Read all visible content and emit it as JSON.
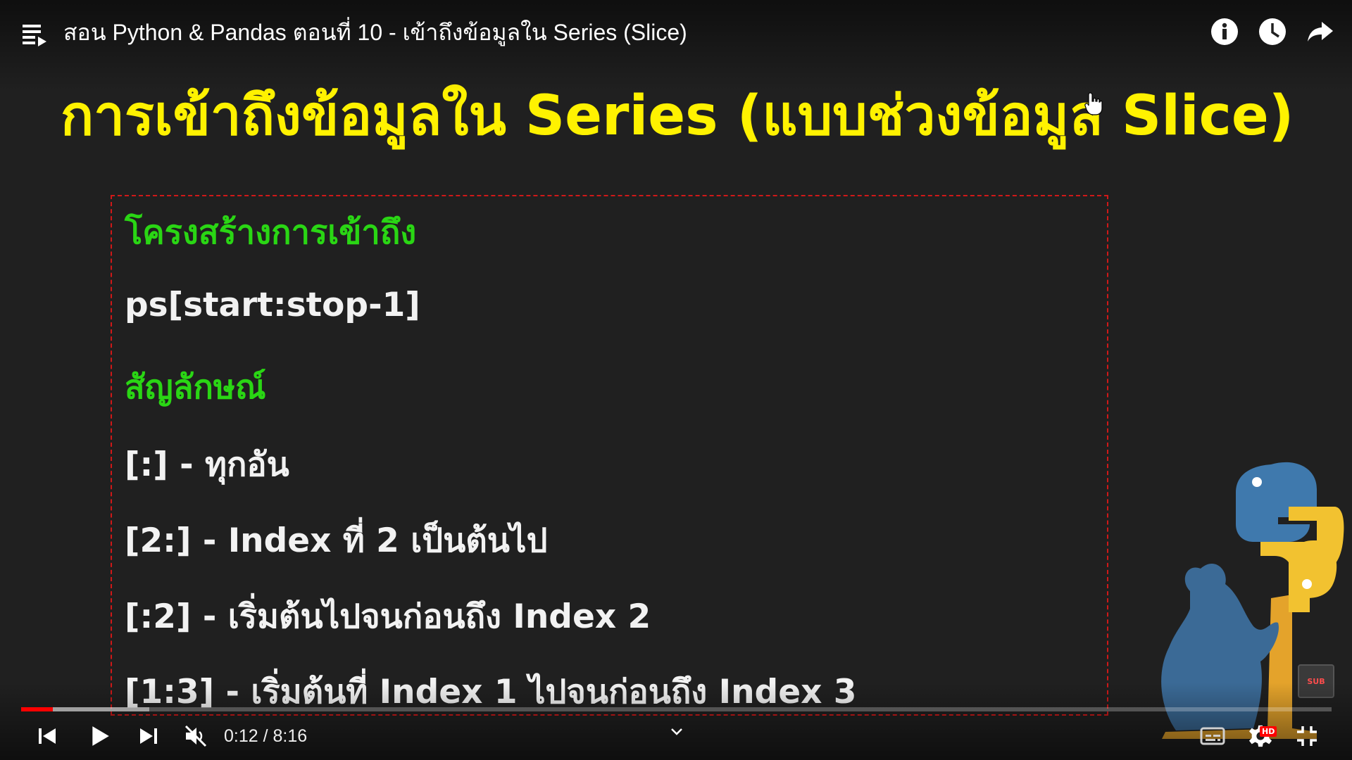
{
  "header": {
    "title": "สอน Python & Pandas ตอนที่ 10 - เข้าถึงข้อมูลใน Series (Slice)",
    "icons": [
      "playlist-icon",
      "info-icon",
      "watch-later-icon",
      "share-icon"
    ]
  },
  "slide": {
    "title": "การเข้าถึงข้อมูลใน Series (แบบช่วงข้อมูล Slice)",
    "structure_heading": "โครงสร้างการเข้าถึง",
    "syntax": "ps[start:stop-1]",
    "symbols_heading": "สัญลักษณ์",
    "items": [
      "[:]  - ทุกอัน",
      "[2:] - Index ที่ 2 เป็นต้นไป",
      "[:2] - เริ่มต้นไปจนก่อนถึง Index 2",
      "[1:3] - เริ่มต้นที่ Index 1 ไปจนก่อนถึง Index 3"
    ],
    "colors": {
      "title": "#fff200",
      "heading": "#2ad614",
      "body": "#f2f2f2",
      "box_border": "#d01818"
    }
  },
  "overlay": {
    "sub_badge": "SUB"
  },
  "player": {
    "current_time": "0:12",
    "duration": "8:16",
    "time_text": "0:12 / 8:16",
    "progress_fraction": 0.024,
    "buffered_fraction": 0.098,
    "hd_badge": "HD",
    "accent": "#ff0000",
    "controls": [
      "previous-icon",
      "play-icon",
      "next-icon",
      "muted-volume-icon",
      "chevron-down-icon",
      "subtitles-icon",
      "settings-icon",
      "exit-fullscreen-icon"
    ]
  }
}
